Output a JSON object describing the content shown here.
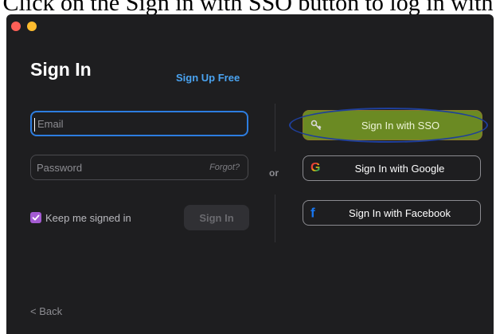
{
  "caption": {
    "text": "Click on the Sign in with SSO button to log in with"
  },
  "window": {
    "controls": [
      "close",
      "minimize"
    ]
  },
  "signin": {
    "title": "Sign In",
    "signup_link": "Sign Up Free",
    "email_placeholder": "Email",
    "password_placeholder": "Password",
    "forgot_label": "Forgot?",
    "keep_signed_in_label": "Keep me signed in",
    "keep_signed_in_checked": true,
    "signin_button": "Sign In",
    "or_label": "or",
    "back_label": "< Back"
  },
  "sso": {
    "sso_label": "Sign In with SSO",
    "google_label": "Sign In with Google",
    "facebook_label": "Sign In with Facebook",
    "icons": [
      "key-icon",
      "google-icon",
      "facebook-icon"
    ]
  },
  "colors": {
    "window_bg": "#1e1e20",
    "accent_blue": "#2d7de0",
    "link_blue": "#4aa3f0",
    "checkbox_purple": "#a45bd2",
    "sso_highlight": "#6b8a23",
    "annotation_ellipse": "#1f3f9a"
  }
}
